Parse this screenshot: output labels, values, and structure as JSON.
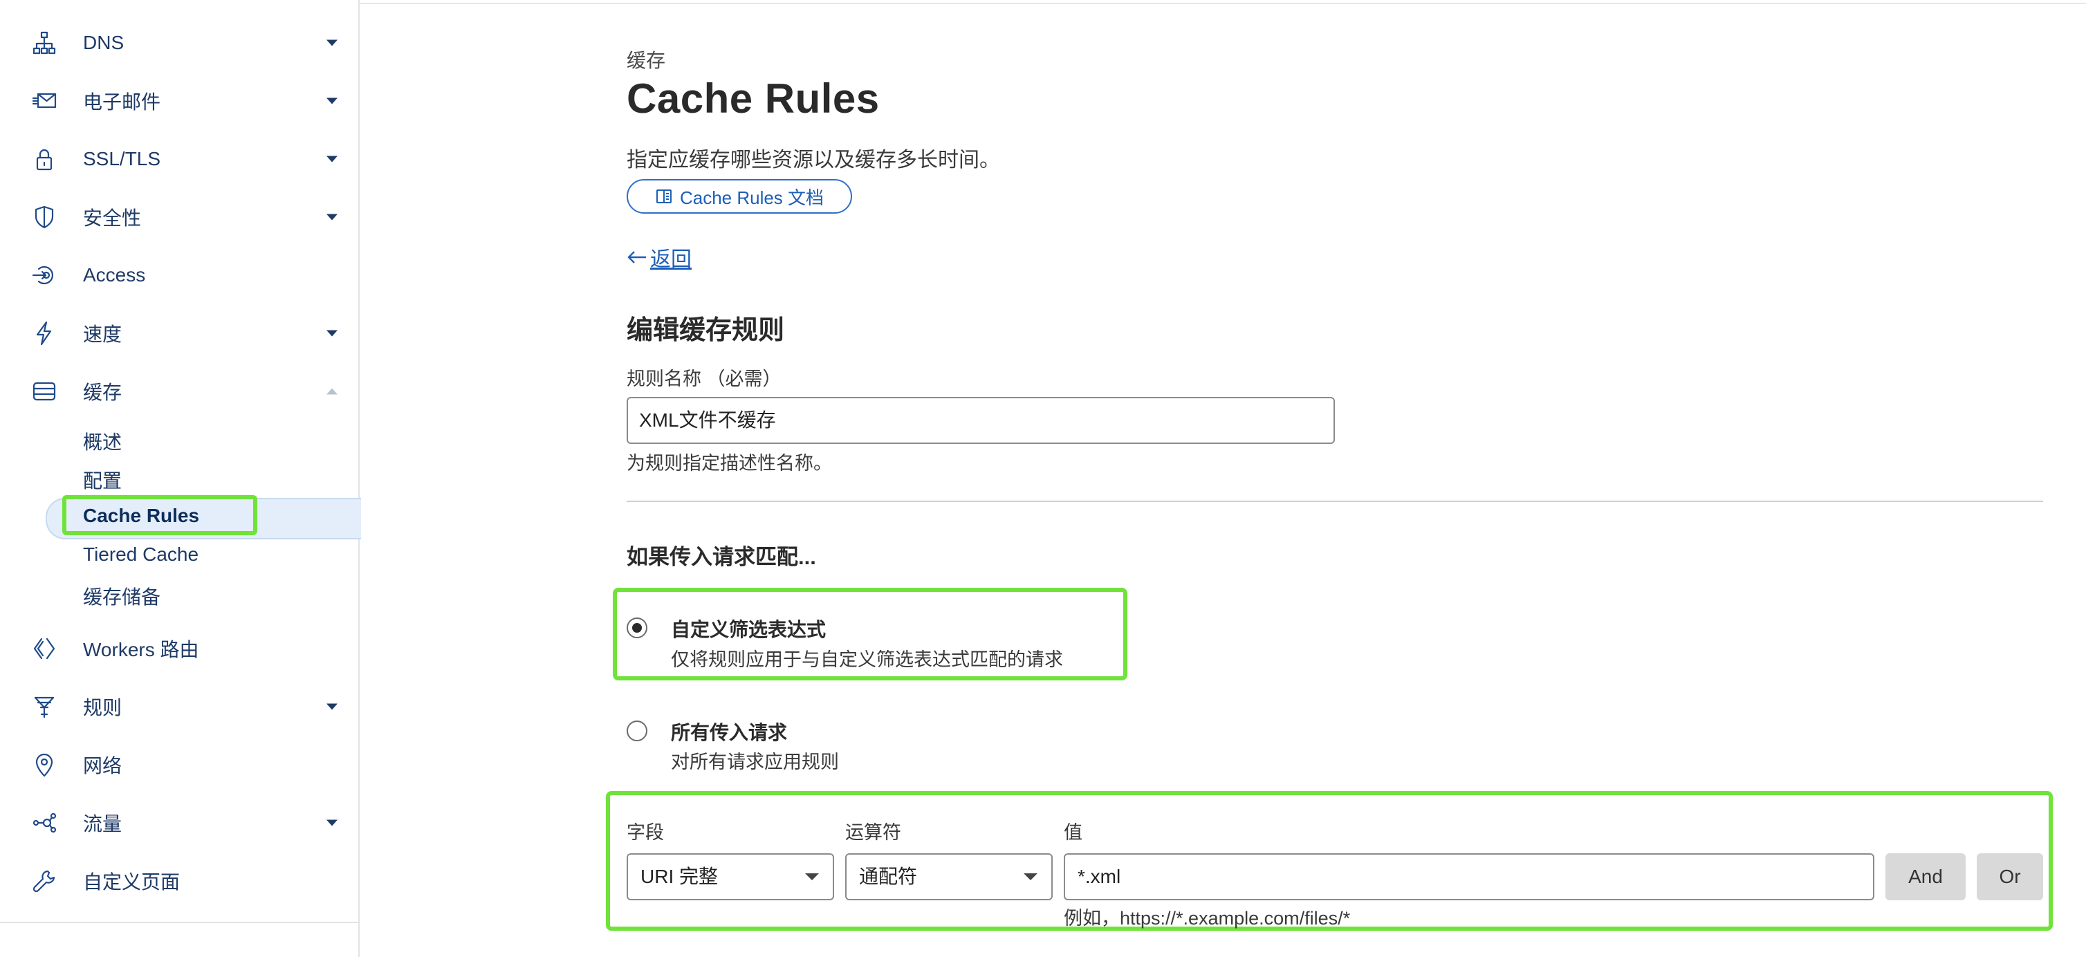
{
  "sidebar": {
    "items": [
      {
        "label": "DNS",
        "icon": "network-tree-icon",
        "caret": "down"
      },
      {
        "label": "电子邮件",
        "icon": "mail-icon",
        "caret": "down"
      },
      {
        "label": "SSL/TLS",
        "icon": "lock-icon",
        "caret": "down"
      },
      {
        "label": "安全性",
        "icon": "shield-icon",
        "caret": "down"
      },
      {
        "label": "Access",
        "icon": "access-icon",
        "caret": "none"
      },
      {
        "label": "速度",
        "icon": "lightning-icon",
        "caret": "down"
      },
      {
        "label": "缓存",
        "icon": "storage-icon",
        "caret": "up"
      },
      {
        "label": "Workers 路由",
        "icon": "workers-icon",
        "caret": "none"
      },
      {
        "label": "规则",
        "icon": "funnel-icon",
        "caret": "down"
      },
      {
        "label": "网络",
        "icon": "location-pin-icon",
        "caret": "none"
      },
      {
        "label": "流量",
        "icon": "traffic-icon",
        "caret": "down"
      },
      {
        "label": "自定义页面",
        "icon": "wrench-icon",
        "caret": "none"
      }
    ],
    "cache_subitems": [
      "概述",
      "配置",
      "Cache Rules",
      "Tiered Cache",
      "缓存储备"
    ],
    "active_subitem": "Cache Rules"
  },
  "main": {
    "section": "缓存",
    "title": "Cache Rules",
    "description": "指定应缓存哪些资源以及缓存多长时间。",
    "doc_button": "Cache Rules 文档",
    "back_label": "返回",
    "edit_heading": "编辑缓存规则",
    "rule_name_label": "规则名称 （必需）",
    "rule_name_value": "XML文件不缓存",
    "rule_name_help": "为规则指定描述性名称。",
    "match_heading": "如果传入请求匹配...",
    "options": [
      {
        "title": "自定义筛选表达式",
        "subtitle": "仅将规则应用于与自定义筛选表达式匹配的请求",
        "checked": true
      },
      {
        "title": "所有传入请求",
        "subtitle": "对所有请求应用规则",
        "checked": false
      }
    ],
    "expression": {
      "field_label": "字段",
      "operator_label": "运算符",
      "value_label": "值",
      "field_value": "URI 完整",
      "operator_value": "通配符",
      "value": "*.xml",
      "and_label": "And",
      "or_label": "Or",
      "example": "例如，https://*.example.com/files/*"
    }
  },
  "colors": {
    "highlight": "#6fe339",
    "link": "#1d5fb8",
    "sidebar_text": "#1e3a66",
    "active_bg": "#e4eefa"
  }
}
